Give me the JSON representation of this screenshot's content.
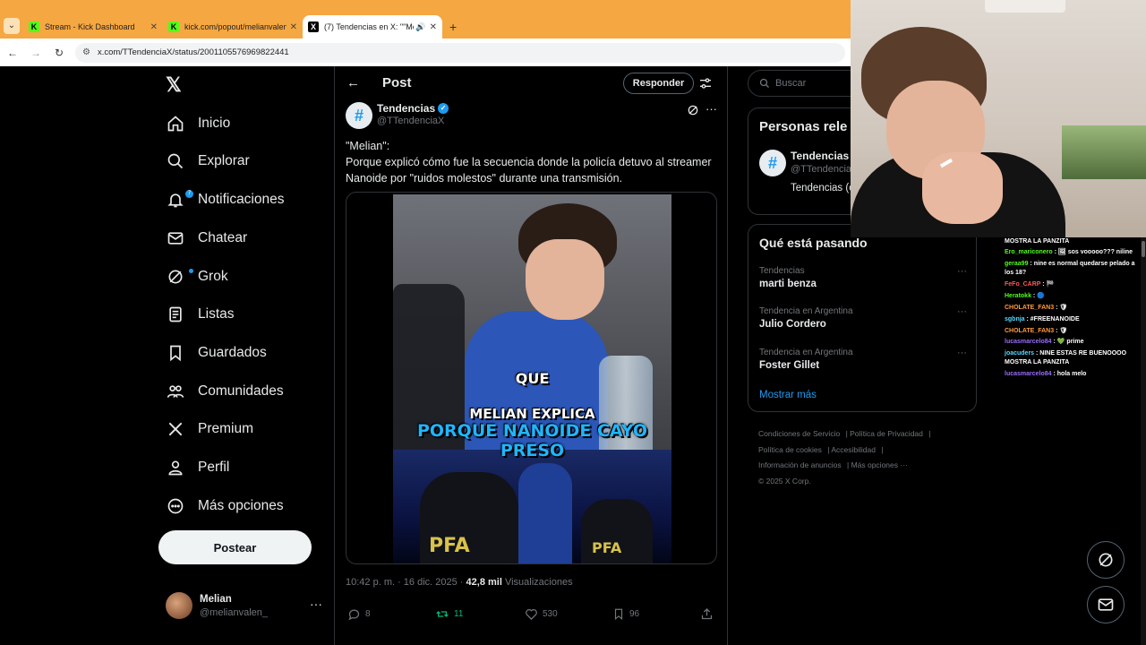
{
  "browser": {
    "tabs": [
      {
        "title": "Stream - Kick Dashboard",
        "favicon": "kick-icon",
        "active": false
      },
      {
        "title": "kick.com/popout/melianvalen/",
        "favicon": "kick-icon",
        "active": false
      },
      {
        "title": "(7) Tendencias en X: \"\"Meli",
        "favicon": "x-icon",
        "active": true
      }
    ],
    "url": "x.com/TTendenciaX/status/2001105576969822441"
  },
  "sidebar": {
    "items": [
      {
        "label": "Inicio",
        "icon": "home-icon"
      },
      {
        "label": "Explorar",
        "icon": "search-icon"
      },
      {
        "label": "Notificaciones",
        "icon": "bell-icon"
      },
      {
        "label": "Chatear",
        "icon": "mail-icon"
      },
      {
        "label": "Grok",
        "icon": "grok-icon"
      },
      {
        "label": "Listas",
        "icon": "list-icon"
      },
      {
        "label": "Guardados",
        "icon": "bookmark-icon"
      },
      {
        "label": "Comunidades",
        "icon": "communities-icon"
      },
      {
        "label": "Premium",
        "icon": "x-icon"
      },
      {
        "label": "Perfil",
        "icon": "user-icon"
      },
      {
        "label": "Más opciones",
        "icon": "more-circle-icon"
      }
    ],
    "notif_badge": "7",
    "post_button": "Postear",
    "account": {
      "name": "Melian",
      "handle": "@melianvalen_"
    }
  },
  "main": {
    "header_title": "Post",
    "reply_button": "Responder",
    "author": {
      "name": "Tendencias",
      "handle": "@TTendenciaX",
      "avatar_glyph": "#"
    },
    "text_line1": "\"Melian\":",
    "text_line2": "Porque explicó cómo fue la secuencia donde la policía detuvo al streamer Nanoide por \"ruidos molestos\" durante una transmisión.",
    "media_captions": {
      "line1": "QUE",
      "line2": "MELIAN EXPLICA",
      "line3": "PORQUE NANOIDE CAYO PRESO",
      "badge1": "PFA",
      "badge2": "PFA"
    },
    "meta": {
      "time": "10:42 p. m. · 16 dic. 2025 · ",
      "views_count": "42,8 mil",
      "views_label": " Visualizaciones"
    },
    "actions": {
      "replies": "8",
      "reposts": "11",
      "likes": "530",
      "bookmarks": "96"
    }
  },
  "right": {
    "search_placeholder": "Buscar",
    "relevant": {
      "title": "Personas rele",
      "name": "Tendencias",
      "handle": "@TTendencia",
      "bio": "Tendencias (c Parodia."
    },
    "trending": {
      "title": "Qué está pasando",
      "items": [
        {
          "category": "Tendencias",
          "name": "marti benza"
        },
        {
          "category": "Tendencia en Argentina",
          "name": "Julio Cordero"
        },
        {
          "category": "Tendencia en Argentina",
          "name": "Foster Gillet"
        }
      ],
      "show_more": "Mostrar más"
    },
    "footer": {
      "links": [
        "Condiciones de Servicio",
        "Política de Privacidad",
        "Política de cookies",
        "Accesibilidad",
        "Información de anuncios",
        "Más opciones ···"
      ],
      "copyright": "© 2025 X Corp."
    }
  },
  "chat": {
    "messages": [
      {
        "user": "",
        "text": "MOSTRA LA PANZITA",
        "color": "#ffffff"
      },
      {
        "user": "Ero_mariconero",
        "text": ": 🖼 sos vooooo??? niline",
        "color": "#53fc18"
      },
      {
        "user": "geraa99",
        "text": ": nine es normal quedarse pelado a los 18?",
        "color": "#53fc18"
      },
      {
        "user": "FeFo_CARP",
        "text": ": 🏁",
        "color": "#ff5a5a"
      },
      {
        "user": "Heratokk",
        "text": ": 🔵",
        "color": "#53fc18"
      },
      {
        "user": "CHOLATE_FAN3",
        "text": ": 🛡",
        "color": "#ff9a3c"
      },
      {
        "user": "sgbnja",
        "text": ": #FREENANOIDE",
        "color": "#59d7ff"
      },
      {
        "user": "CHOLATE_FAN3",
        "text": ": 🛡",
        "color": "#ff9a3c"
      },
      {
        "user": "lucasmarcelo84",
        "text": ": 💚 prime",
        "color": "#9b6cff"
      },
      {
        "user": "joacuders",
        "text": ": NINE ESTAS RE BUENOOOO MOSTRA LA PANZITA",
        "color": "#59d7ff"
      },
      {
        "user": "lucasmarcelo84",
        "text": ": hola melo",
        "color": "#9b6cff"
      }
    ]
  },
  "colors": {
    "accent": "#1d9bf0",
    "repost": "#00ba7c",
    "kick": "#53fc18",
    "tabbar": "#f5a742"
  }
}
